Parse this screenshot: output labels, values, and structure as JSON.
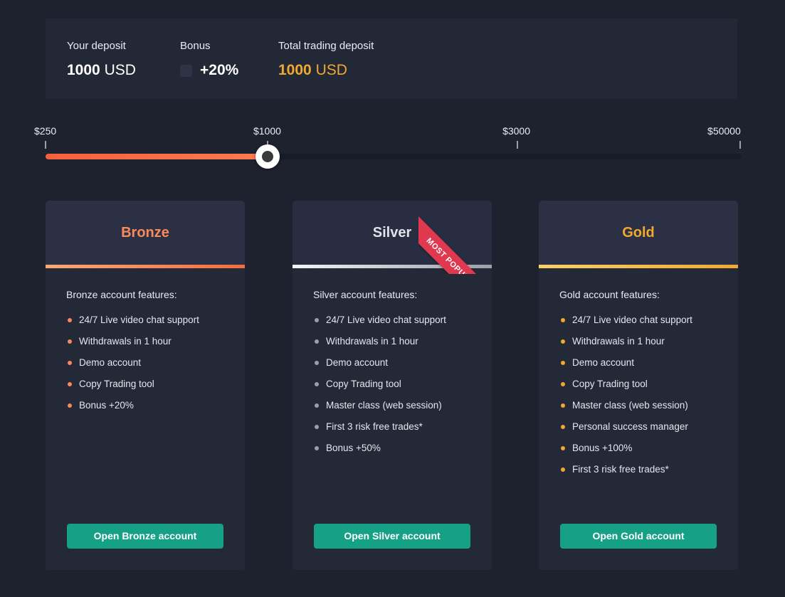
{
  "summary": {
    "deposit_label": "Your deposit",
    "deposit_amount": "1000",
    "deposit_currency": "USD",
    "bonus_label": "Bonus",
    "bonus_value": "+20%",
    "bonus_checked": false,
    "total_label": "Total trading deposit",
    "total_amount": "1000",
    "total_currency": "USD",
    "total_color": "#f0a92e"
  },
  "slider": {
    "current_value": "$1000",
    "fill_percent": 31.9,
    "knob_percent": 31.9,
    "stops": [
      {
        "label": "$250",
        "position_percent": 0.0
      },
      {
        "label": "$1000",
        "position_percent": 31.9
      },
      {
        "label": "$3000",
        "position_percent": 67.8
      },
      {
        "label": "$50000",
        "position_percent": 99.8
      }
    ],
    "fill_color": "#f5603c",
    "track_color": "#171b26"
  },
  "plans": [
    {
      "id": "bronze",
      "title": "Bronze",
      "accent_color": "#f98a5b",
      "features_title": "Bronze account features:",
      "features": [
        "24/7 Live video chat support",
        "Withdrawals in 1 hour",
        "Demo account",
        "Copy Trading tool",
        "Bonus +20%"
      ],
      "cta_label": "Open Bronze account",
      "ribbon": null
    },
    {
      "id": "silver",
      "title": "Silver",
      "accent_color": "#dfe3ea",
      "features_title": "Silver account features:",
      "features": [
        "24/7 Live video chat support",
        "Withdrawals in 1 hour",
        "Demo account",
        "Copy Trading tool",
        "Master class (web session)",
        "First 3 risk free trades*",
        "Bonus +50%"
      ],
      "cta_label": "Open Silver account",
      "ribbon": "MOST POPULAR"
    },
    {
      "id": "gold",
      "title": "Gold",
      "accent_color": "#f0a92e",
      "features_title": "Gold account features:",
      "features": [
        "24/7 Live video chat support",
        "Withdrawals in 1 hour",
        "Demo account",
        "Copy Trading tool",
        "Master class (web session)",
        "Personal success manager",
        "Bonus +100%",
        "First 3 risk free trades*"
      ],
      "cta_label": "Open Gold account",
      "ribbon": null
    }
  ],
  "theme": {
    "page_bg": "#1e222f",
    "panel_bg": "#232836",
    "card_bg": "#242938",
    "card_head_bg": "#2b3044",
    "cta_color": "#16a085",
    "ribbon_color": "#e0384f"
  }
}
